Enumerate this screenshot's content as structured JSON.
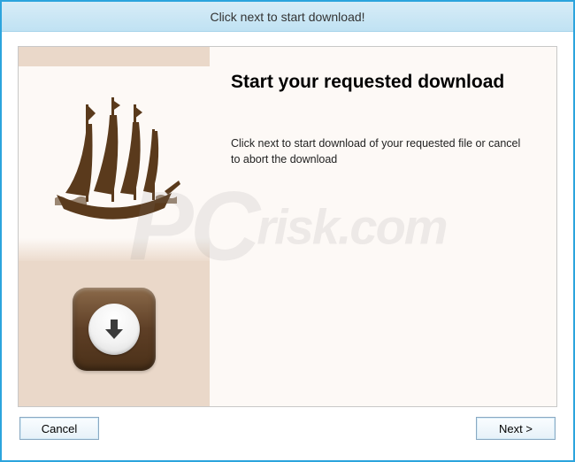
{
  "titlebar": {
    "text": "Click next to start download!"
  },
  "main": {
    "heading": "Start your requested download",
    "body": "Click next to start download of your requested file or cancel to abort the download"
  },
  "buttons": {
    "cancel": "Cancel",
    "next": "Next >"
  },
  "icons": {
    "ship": "pirate-ship-icon",
    "download": "download-arrow-icon"
  },
  "watermark": {
    "main": "PC",
    "sub": "risk.com"
  }
}
